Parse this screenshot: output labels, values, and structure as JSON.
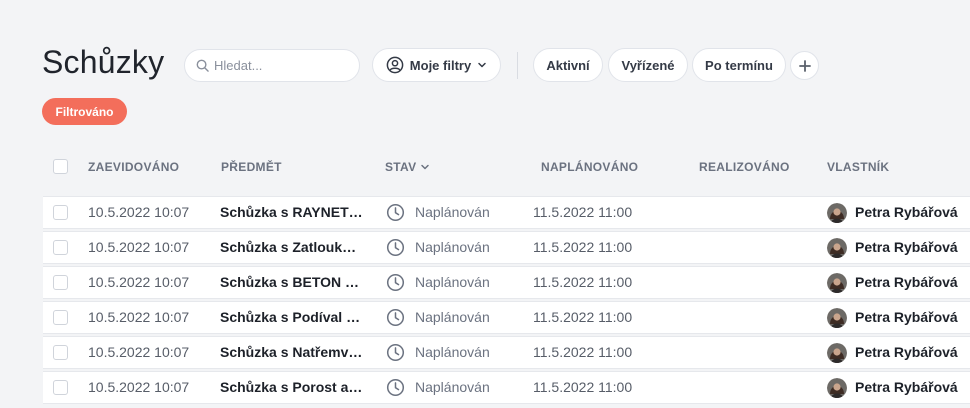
{
  "header": {
    "title": "Schůzky",
    "search_placeholder": "Hledat...",
    "filters_label": "Moje filtry",
    "quick_filters": [
      "Aktivní",
      "Vyřízené",
      "Po termínu"
    ],
    "active_filter_badge": "Filtrováno"
  },
  "table": {
    "columns": [
      "ZAEVIDOVÁNO",
      "PŘEDMĚT",
      "STAV",
      "NAPLÁNOVÁNO",
      "REALIZOVÁNO",
      "VLASTNÍK"
    ],
    "rows": [
      {
        "created": "10.5.2022 10:07",
        "subject": "Schůzka s RAYNET s.r.o.",
        "status": "Naplánován",
        "planned": "11.5.2022 11:00",
        "realized": "",
        "owner": "Petra Rybářová"
      },
      {
        "created": "10.5.2022 10:07",
        "subject": "Schůzka s Zatloukat s.r.o.",
        "status": "Naplánován",
        "planned": "11.5.2022 11:00",
        "realized": "",
        "owner": "Petra Rybářová"
      },
      {
        "created": "10.5.2022 10:07",
        "subject": "Schůzka s BETON Engineering",
        "status": "Naplánován",
        "planned": "11.5.2022 11:00",
        "realized": "",
        "owner": "Petra Rybářová"
      },
      {
        "created": "10.5.2022 10:07",
        "subject": "Schůzka s Podíval & syn",
        "status": "Naplánován",
        "planned": "11.5.2022 11:00",
        "realized": "",
        "owner": "Petra Rybářová"
      },
      {
        "created": "10.5.2022 10:07",
        "subject": "Schůzka s Natřemvám s.r.o.",
        "status": "Naplánován",
        "planned": "11.5.2022 11:00",
        "realized": "",
        "owner": "Petra Rybářová"
      },
      {
        "created": "10.5.2022 10:07",
        "subject": "Schůzka s Porost a.s.",
        "status": "Naplánován",
        "planned": "11.5.2022 11:00",
        "realized": "",
        "owner": "Petra Rybářová"
      }
    ]
  },
  "icons": {
    "search": "search-icon",
    "filters": "user-circle-icon",
    "filters_chevron": "chevron-down-icon",
    "add": "plus-icon",
    "sort": "chevron-down-icon",
    "status": "clock-icon",
    "owner": "avatar"
  },
  "colors": {
    "background": "#f3f4f6",
    "badge": "#f36e5b",
    "row": "#ffffff"
  }
}
